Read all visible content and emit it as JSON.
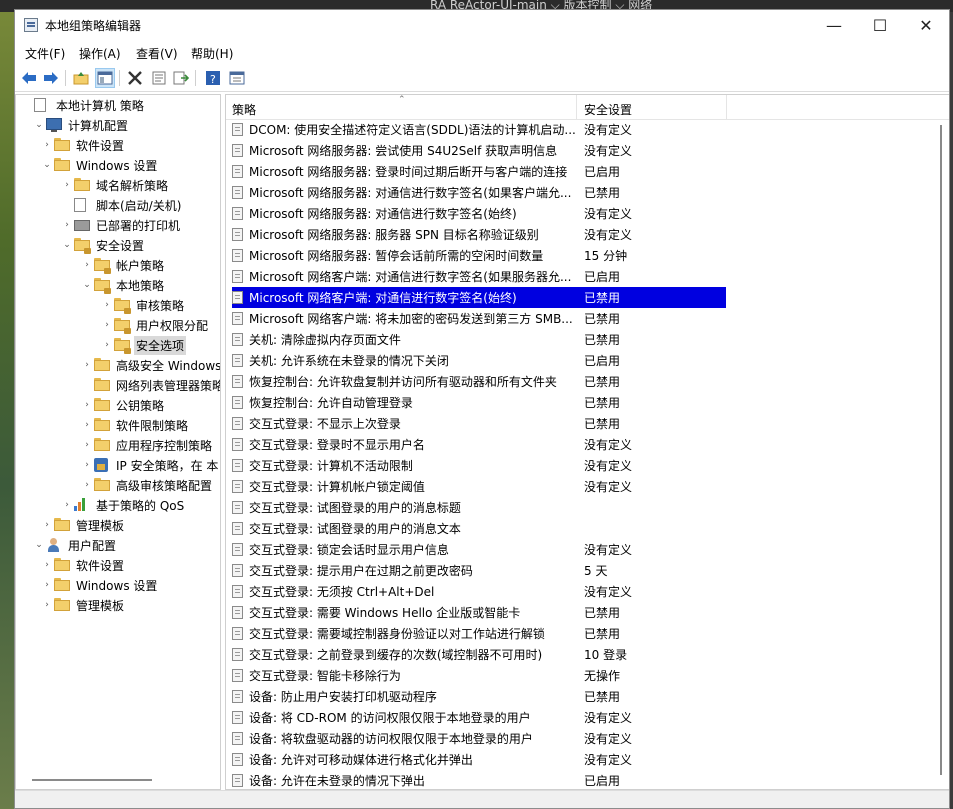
{
  "background": {
    "taskbar_text": "RA  ReActor-UI-main  ⌵    版本控制  ⌵         网络"
  },
  "window": {
    "title": "本地组策略编辑器",
    "min": "—",
    "max": "☐",
    "close": "✕"
  },
  "menu": [
    "文件(F)",
    "操作(A)",
    "查看(V)",
    "帮助(H)"
  ],
  "tree": [
    {
      "label": "本地计算机 策略",
      "icon": "doc-icon",
      "level": 0,
      "arrow": ""
    },
    {
      "label": "计算机配置",
      "icon": "computer-icon",
      "level": 1,
      "arrow": "⌄"
    },
    {
      "label": "软件设置",
      "icon": "folder-icon",
      "level": 2,
      "arrow": "›"
    },
    {
      "label": "Windows 设置",
      "icon": "folder-icon",
      "level": 2,
      "arrow": "⌄"
    },
    {
      "label": "域名解析策略",
      "icon": "folder-icon",
      "level": 3,
      "arrow": "›"
    },
    {
      "label": "脚本(启动/关机)",
      "icon": "doc-icon",
      "level": 3,
      "arrow": ""
    },
    {
      "label": "已部署的打印机",
      "icon": "printer-icon",
      "level": 3,
      "arrow": "›"
    },
    {
      "label": "安全设置",
      "icon": "lock-folder-icon",
      "level": 3,
      "arrow": "⌄"
    },
    {
      "label": "帐户策略",
      "icon": "lock-folder-icon",
      "level": 4,
      "arrow": "›"
    },
    {
      "label": "本地策略",
      "icon": "lock-folder-icon",
      "level": 4,
      "arrow": "⌄"
    },
    {
      "label": "审核策略",
      "icon": "lock-folder-icon",
      "level": 5,
      "arrow": "›"
    },
    {
      "label": "用户权限分配",
      "icon": "lock-folder-icon",
      "level": 5,
      "arrow": "›"
    },
    {
      "label": "安全选项",
      "icon": "lock-folder-icon",
      "level": 5,
      "arrow": "›",
      "selected": true
    },
    {
      "label": "高级安全 Windows",
      "icon": "folder-icon",
      "level": 4,
      "arrow": "›"
    },
    {
      "label": "网络列表管理器策略",
      "icon": "folder-icon",
      "level": 4,
      "arrow": ""
    },
    {
      "label": "公钥策略",
      "icon": "folder-icon",
      "level": 4,
      "arrow": "›"
    },
    {
      "label": "软件限制策略",
      "icon": "folder-icon",
      "level": 4,
      "arrow": "›"
    },
    {
      "label": "应用程序控制策略",
      "icon": "folder-icon",
      "level": 4,
      "arrow": "›"
    },
    {
      "label": "IP 安全策略，在 本",
      "icon": "ipsec-icon",
      "level": 4,
      "arrow": "›"
    },
    {
      "label": "高级审核策略配置",
      "icon": "folder-icon",
      "level": 4,
      "arrow": "›"
    },
    {
      "label": "基于策略的 QoS",
      "icon": "qos-icon",
      "level": 3,
      "arrow": "›"
    },
    {
      "label": "管理模板",
      "icon": "folder-icon",
      "level": 2,
      "arrow": "›"
    },
    {
      "label": "用户配置",
      "icon": "user-icon",
      "level": 1,
      "arrow": "⌄"
    },
    {
      "label": "软件设置",
      "icon": "folder-icon",
      "level": 2,
      "arrow": "›"
    },
    {
      "label": "Windows 设置",
      "icon": "folder-icon",
      "level": 2,
      "arrow": "›"
    },
    {
      "label": "管理模板",
      "icon": "folder-icon",
      "level": 2,
      "arrow": "›"
    }
  ],
  "list": {
    "col_policy": "策略",
    "col_setting": "安全设置",
    "sort_indicator": "⌃",
    "rows": [
      {
        "policy": "DCOM: 使用安全描述符定义语言(SDDL)语法的计算机启动...",
        "setting": "没有定义"
      },
      {
        "policy": "Microsoft 网络服务器: 尝试使用 S4U2Self 获取声明信息",
        "setting": "没有定义"
      },
      {
        "policy": "Microsoft 网络服务器: 登录时间过期后断开与客户端的连接",
        "setting": "已启用"
      },
      {
        "policy": "Microsoft 网络服务器: 对通信进行数字签名(如果客户端允...",
        "setting": "已禁用"
      },
      {
        "policy": "Microsoft 网络服务器: 对通信进行数字签名(始终)",
        "setting": "没有定义"
      },
      {
        "policy": "Microsoft 网络服务器: 服务器 SPN 目标名称验证级别",
        "setting": "没有定义"
      },
      {
        "policy": "Microsoft 网络服务器: 暂停会话前所需的空闲时间数量",
        "setting": "15 分钟"
      },
      {
        "policy": "Microsoft 网络客户端: 对通信进行数字签名(如果服务器允...",
        "setting": "已启用"
      },
      {
        "policy": "Microsoft 网络客户端: 对通信进行数字签名(始终)",
        "setting": "已禁用",
        "selected": true
      },
      {
        "policy": "Microsoft 网络客户端: 将未加密的密码发送到第三方 SMB...",
        "setting": "已禁用"
      },
      {
        "policy": "关机: 清除虚拟内存页面文件",
        "setting": "已禁用"
      },
      {
        "policy": "关机: 允许系统在未登录的情况下关闭",
        "setting": "已启用"
      },
      {
        "policy": "恢复控制台: 允许软盘复制并访问所有驱动器和所有文件夹",
        "setting": "已禁用"
      },
      {
        "policy": "恢复控制台: 允许自动管理登录",
        "setting": "已禁用"
      },
      {
        "policy": "交互式登录: 不显示上次登录",
        "setting": "已禁用"
      },
      {
        "policy": "交互式登录: 登录时不显示用户名",
        "setting": "没有定义"
      },
      {
        "policy": "交互式登录: 计算机不活动限制",
        "setting": "没有定义"
      },
      {
        "policy": "交互式登录: 计算机帐户锁定阈值",
        "setting": "没有定义"
      },
      {
        "policy": "交互式登录: 试图登录的用户的消息标题",
        "setting": ""
      },
      {
        "policy": "交互式登录: 试图登录的用户的消息文本",
        "setting": ""
      },
      {
        "policy": "交互式登录: 锁定会话时显示用户信息",
        "setting": "没有定义"
      },
      {
        "policy": "交互式登录: 提示用户在过期之前更改密码",
        "setting": "5 天"
      },
      {
        "policy": "交互式登录: 无须按 Ctrl+Alt+Del",
        "setting": "没有定义"
      },
      {
        "policy": "交互式登录: 需要 Windows Hello 企业版或智能卡",
        "setting": "已禁用"
      },
      {
        "policy": "交互式登录: 需要域控制器身份验证以对工作站进行解锁",
        "setting": "已禁用"
      },
      {
        "policy": "交互式登录: 之前登录到缓存的次数(域控制器不可用时)",
        "setting": "10 登录"
      },
      {
        "policy": "交互式登录: 智能卡移除行为",
        "setting": "无操作"
      },
      {
        "policy": "设备: 防止用户安装打印机驱动程序",
        "setting": "已禁用"
      },
      {
        "policy": "设备: 将 CD-ROM 的访问权限仅限于本地登录的用户",
        "setting": "没有定义"
      },
      {
        "policy": "设备: 将软盘驱动器的访问权限仅限于本地登录的用户",
        "setting": "没有定义"
      },
      {
        "policy": "设备: 允许对可移动媒体进行格式化并弹出",
        "setting": "没有定义"
      },
      {
        "policy": "设备: 允许在未登录的情况下弹出",
        "setting": "已启用"
      }
    ]
  }
}
